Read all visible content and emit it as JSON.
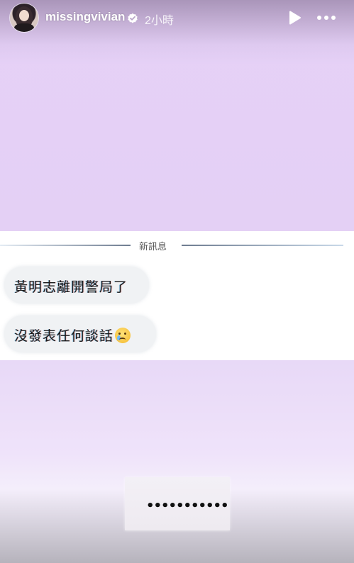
{
  "header": {
    "username": "missingvivian",
    "time": "2小時",
    "verified_icon": "verified-badge-icon",
    "play_icon": "play-icon",
    "more_icon": "more-options-icon"
  },
  "panel": {
    "divider_label": "新訊息",
    "messages": [
      {
        "text": "黃明志離開警局了"
      },
      {
        "text": "沒發表任何談話"
      }
    ],
    "emoji_icon": "face-holding-back-tears-icon"
  },
  "caption": {
    "text": "•••••••••••"
  },
  "colors": {
    "background_lavender": "#e6d1f7",
    "panel_white": "#ffffff",
    "bubble_gray": "#f0f2f4"
  }
}
